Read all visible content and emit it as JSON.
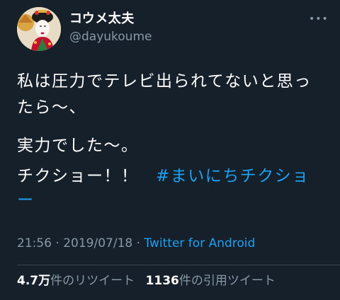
{
  "author": {
    "display_name": "コウメ太夫",
    "handle": "@dayukoume",
    "avatar_icon": "kabuki-portrait-avatar"
  },
  "menu_icon": "more-dots-icon",
  "tweet": {
    "line1": "私は圧力でテレビ出られてないと思っ",
    "line1b": "たら〜、",
    "line2": "実力でした〜。",
    "line3_text": "チクショー！！　",
    "hashtag_part1": "#まいにちチクショ",
    "hashtag_part2": "ー"
  },
  "meta": {
    "time": "21:56",
    "sep1": " · ",
    "date": "2019/07/18",
    "sep2": " · ",
    "source": "Twitter for Android"
  },
  "stats": {
    "retweets_count": "4.7万",
    "retweets_label": "件のリツイート",
    "quotes_count": "1136",
    "quotes_label": "件の引用ツイート"
  },
  "colors": {
    "background": "#15202b",
    "link": "#1da1f2",
    "muted": "#8899a6"
  }
}
